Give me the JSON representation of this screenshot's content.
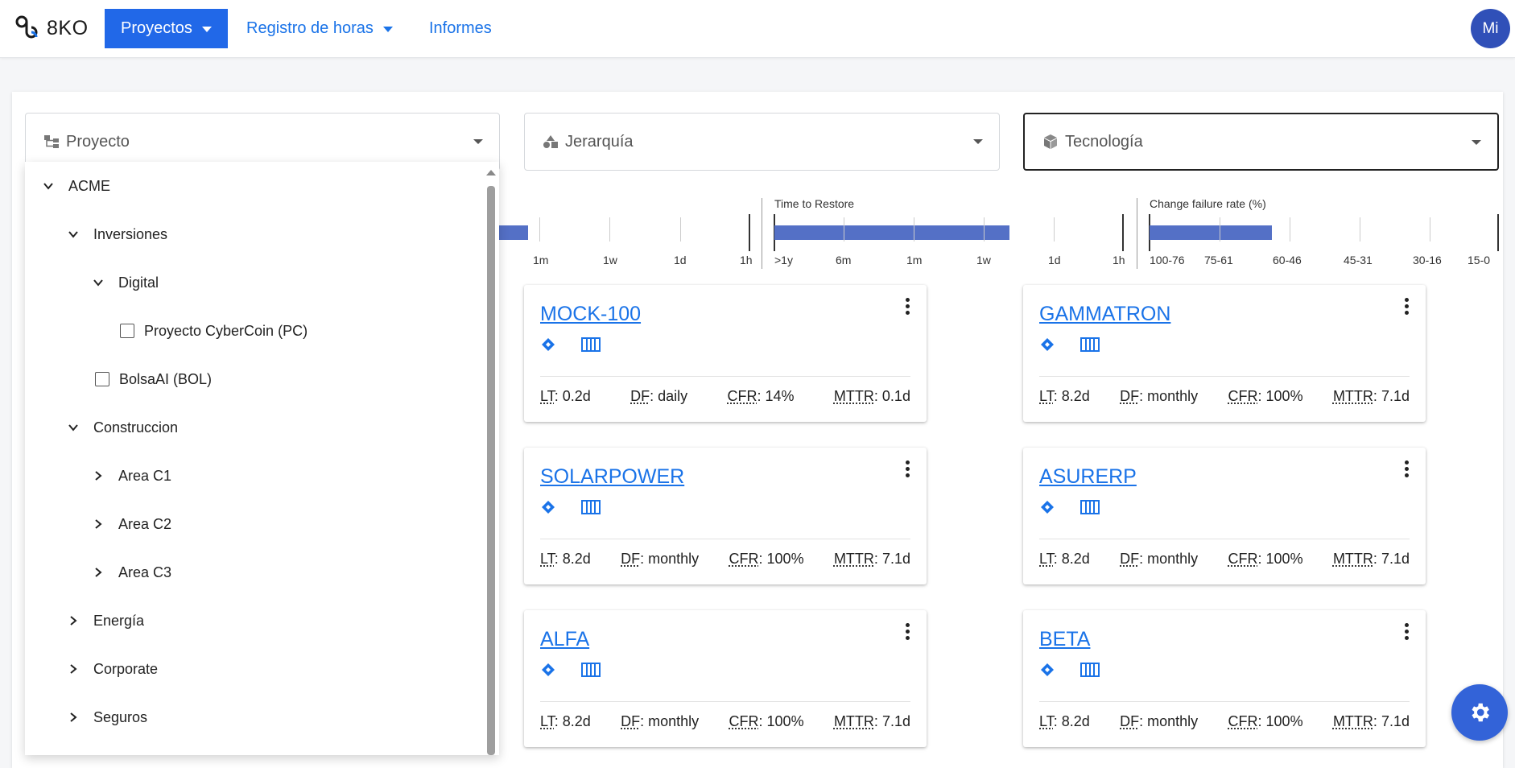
{
  "app": {
    "brand": "8KO",
    "avatar_initials": "Mi"
  },
  "nav": {
    "proyectos": "Proyectos",
    "registro_horas": "Registro de horas",
    "informes": "Informes"
  },
  "filters": {
    "proyecto": "Proyecto",
    "jerarquia": "Jerarquía",
    "tecnologia": "Tecnología"
  },
  "metrics": {
    "lead_time": {
      "ticks": [
        "1m",
        "1w",
        "1d",
        "1h"
      ]
    },
    "time_to_restore": {
      "title": "Time to Restore",
      "ticks": [
        ">1y",
        "6m",
        "1m",
        "1w",
        "1d",
        "1h"
      ]
    },
    "change_failure_rate": {
      "title": "Change failure rate (%)",
      "ticks": [
        "100-76",
        "75-61",
        "60-46",
        "45-31",
        "30-16",
        "15-0"
      ]
    }
  },
  "tree": [
    {
      "label": "ACME",
      "type": "expanded"
    },
    {
      "label": "Inversiones",
      "type": "expanded"
    },
    {
      "label": "Digital",
      "type": "expanded"
    },
    {
      "label": "Proyecto CyberCoin (PC)",
      "type": "checkbox"
    },
    {
      "label": "BolsaAI (BOL)",
      "type": "checkbox"
    },
    {
      "label": "Construccion",
      "type": "expanded"
    },
    {
      "label": "Area C1",
      "type": "collapsed"
    },
    {
      "label": "Area C2",
      "type": "collapsed"
    },
    {
      "label": "Area C3",
      "type": "collapsed"
    },
    {
      "label": "Energía",
      "type": "collapsed"
    },
    {
      "label": "Corporate",
      "type": "collapsed"
    },
    {
      "label": "Seguros",
      "type": "collapsed"
    }
  ],
  "cards": [
    {
      "name": "MOCK-100",
      "lt": "0.2d",
      "df": "daily",
      "cfr": "14%",
      "mttr": "0.1d"
    },
    {
      "name": "GAMMATRON",
      "lt": "8.2d",
      "df": "monthly",
      "cfr": "100%",
      "mttr": "7.1d"
    },
    {
      "name": "SOLARPOWER",
      "lt": "8.2d",
      "df": "monthly",
      "cfr": "100%",
      "mttr": "7.1d"
    },
    {
      "name": "ASURERP",
      "lt": "8.2d",
      "df": "monthly",
      "cfr": "100%",
      "mttr": "7.1d"
    },
    {
      "name": "ALFA",
      "lt": "8.2d",
      "df": "monthly",
      "cfr": "100%",
      "mttr": "7.1d"
    },
    {
      "name": "BETA",
      "lt": "8.2d",
      "df": "monthly",
      "cfr": "100%",
      "mttr": "7.1d"
    }
  ],
  "stat_labels": {
    "lt": "LT",
    "df": "DF",
    "cfr": "CFR",
    "mttr": "MTTR"
  },
  "icons": {
    "logo": "8ko-logo-icon",
    "proyecto": "sitemap-icon",
    "jerarquia": "shapes-icon",
    "tecnologia": "cube-icon",
    "card_icon_1": "jira-diamond-icon",
    "card_icon_2": "board-columns-icon",
    "fab": "gear-icon"
  },
  "colors": {
    "primary": "#2168e8",
    "link": "#1a73e8",
    "bar": "#5470c6",
    "avatar": "#3050b8"
  }
}
